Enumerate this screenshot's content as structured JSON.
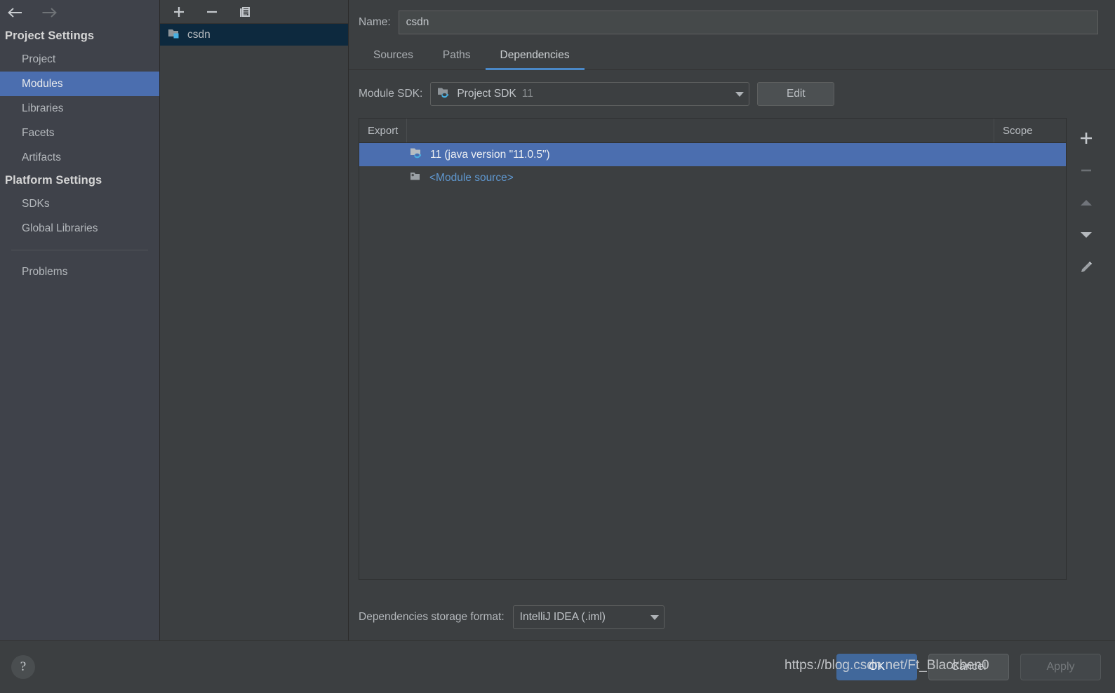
{
  "nav": {
    "back_icon": "arrow-left-icon",
    "forward_icon": "arrow-right-icon"
  },
  "sidebar": {
    "groups": [
      {
        "title": "Project Settings",
        "items": [
          {
            "label": "Project",
            "selected": false
          },
          {
            "label": "Modules",
            "selected": true
          },
          {
            "label": "Libraries",
            "selected": false
          },
          {
            "label": "Facets",
            "selected": false
          },
          {
            "label": "Artifacts",
            "selected": false
          }
        ]
      },
      {
        "title": "Platform Settings",
        "items": [
          {
            "label": "SDKs",
            "selected": false
          },
          {
            "label": "Global Libraries",
            "selected": false
          }
        ]
      }
    ],
    "problems_label": "Problems"
  },
  "modules_panel": {
    "toolbar": [
      {
        "name": "add-module-button",
        "icon": "plus-icon"
      },
      {
        "name": "remove-module-button",
        "icon": "minus-icon"
      },
      {
        "name": "copy-module-button",
        "icon": "copy-icon"
      }
    ],
    "items": [
      {
        "label": "csdn",
        "icon": "module-folder-icon",
        "selected": true
      }
    ]
  },
  "content": {
    "name_label": "Name:",
    "name_value": "csdn",
    "name_placeholder": "",
    "tabs": [
      {
        "label": "Sources",
        "active": false
      },
      {
        "label": "Paths",
        "active": false
      },
      {
        "label": "Dependencies",
        "active": true
      }
    ],
    "sdk_label": "Module SDK:",
    "sdk_value": "Project SDK",
    "sdk_version": "11",
    "sdk_icon": "sdk-folder-icon",
    "edit_button": "Edit",
    "table": {
      "columns": [
        "Export",
        "",
        "Scope"
      ],
      "rows": [
        {
          "export_checked": false,
          "icon": "sdk-folder-icon",
          "name": "11 (java version \"11.0.5\")",
          "scope": "",
          "selected": true,
          "link": false
        },
        {
          "export_checked": false,
          "icon": "module-source-icon",
          "name": "<Module source>",
          "scope": "",
          "selected": false,
          "link": true
        }
      ]
    },
    "table_toolbar": [
      {
        "name": "add-dependency-button",
        "icon": "plus-icon",
        "enabled": true
      },
      {
        "name": "remove-dependency-button",
        "icon": "minus-icon",
        "enabled": false
      },
      {
        "name": "move-up-button",
        "icon": "arrow-up-icon",
        "enabled": false
      },
      {
        "name": "move-down-button",
        "icon": "arrow-down-icon",
        "enabled": true
      },
      {
        "name": "edit-dependency-button",
        "icon": "pencil-icon",
        "enabled": true
      }
    ],
    "storage_label": "Dependencies storage format:",
    "storage_value": "IntelliJ IDEA (.iml)"
  },
  "footer": {
    "help_icon": "question-mark-icon",
    "ok_label": "OK",
    "cancel_label": "Cancel",
    "apply_label": "Apply"
  },
  "watermark": "https://blog.csdn.net/Ft_Blackben0",
  "colors": {
    "background": "#3c3f41",
    "sidebar_background": "#3f424a",
    "selection_blue": "#4b6eaf",
    "inactive_selection": "#0d293e",
    "accent_tab": "#4a88c7",
    "link_blue": "#5f97cf",
    "primary_button": "#41689b"
  }
}
